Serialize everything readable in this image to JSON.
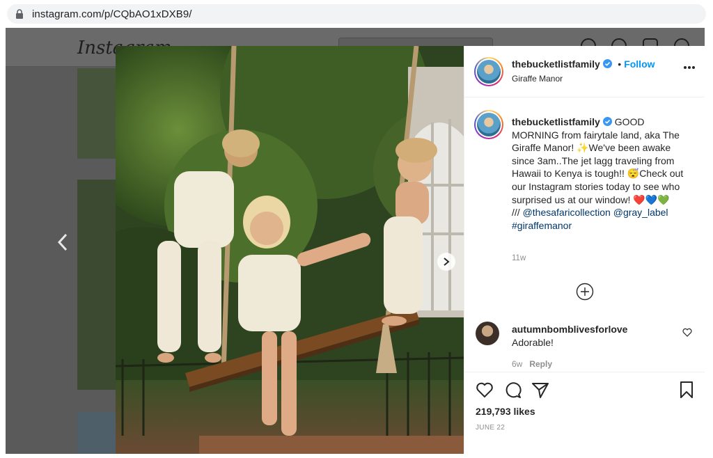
{
  "browser": {
    "url": "instagram.com/p/CQbAO1xDXB9/"
  },
  "background": {
    "logo": "Instagram"
  },
  "post": {
    "username": "thebucketlistfamily",
    "follow_separator": "•",
    "follow_label": "Follow",
    "location": "Giraffe Manor",
    "caption": {
      "username": "thebucketlistfamily",
      "text": "GOOD MORNING from fairytale land, aka The Giraffe Manor! ✨We've been awake since 3am..The jet lagg traveling from Hawaii to Kenya is tough!! 😴Check out our Instagram stories today to see who surprised us at our window! ❤️💙💚",
      "slashes": "///",
      "mention1": "@thesafaricollection",
      "mention2": "@gray_label",
      "hashtag": "#giraffemanor",
      "time": "11w"
    },
    "comment": {
      "username": "autumnbomblivesforlove",
      "text": "Adorable!",
      "time": "6w",
      "reply_label": "Reply"
    },
    "likes": "219,793 likes",
    "date": "JUNE 22"
  },
  "colors": {
    "accent": "#0095f6",
    "link": "#00376b",
    "muted": "#8e8e8e"
  },
  "icons": [
    "lock-icon",
    "verified-icon",
    "more-icon",
    "plus-circle-icon",
    "heart-icon",
    "comment-icon",
    "share-icon",
    "bookmark-icon",
    "chevron-left-icon",
    "chevron-right-icon"
  ]
}
